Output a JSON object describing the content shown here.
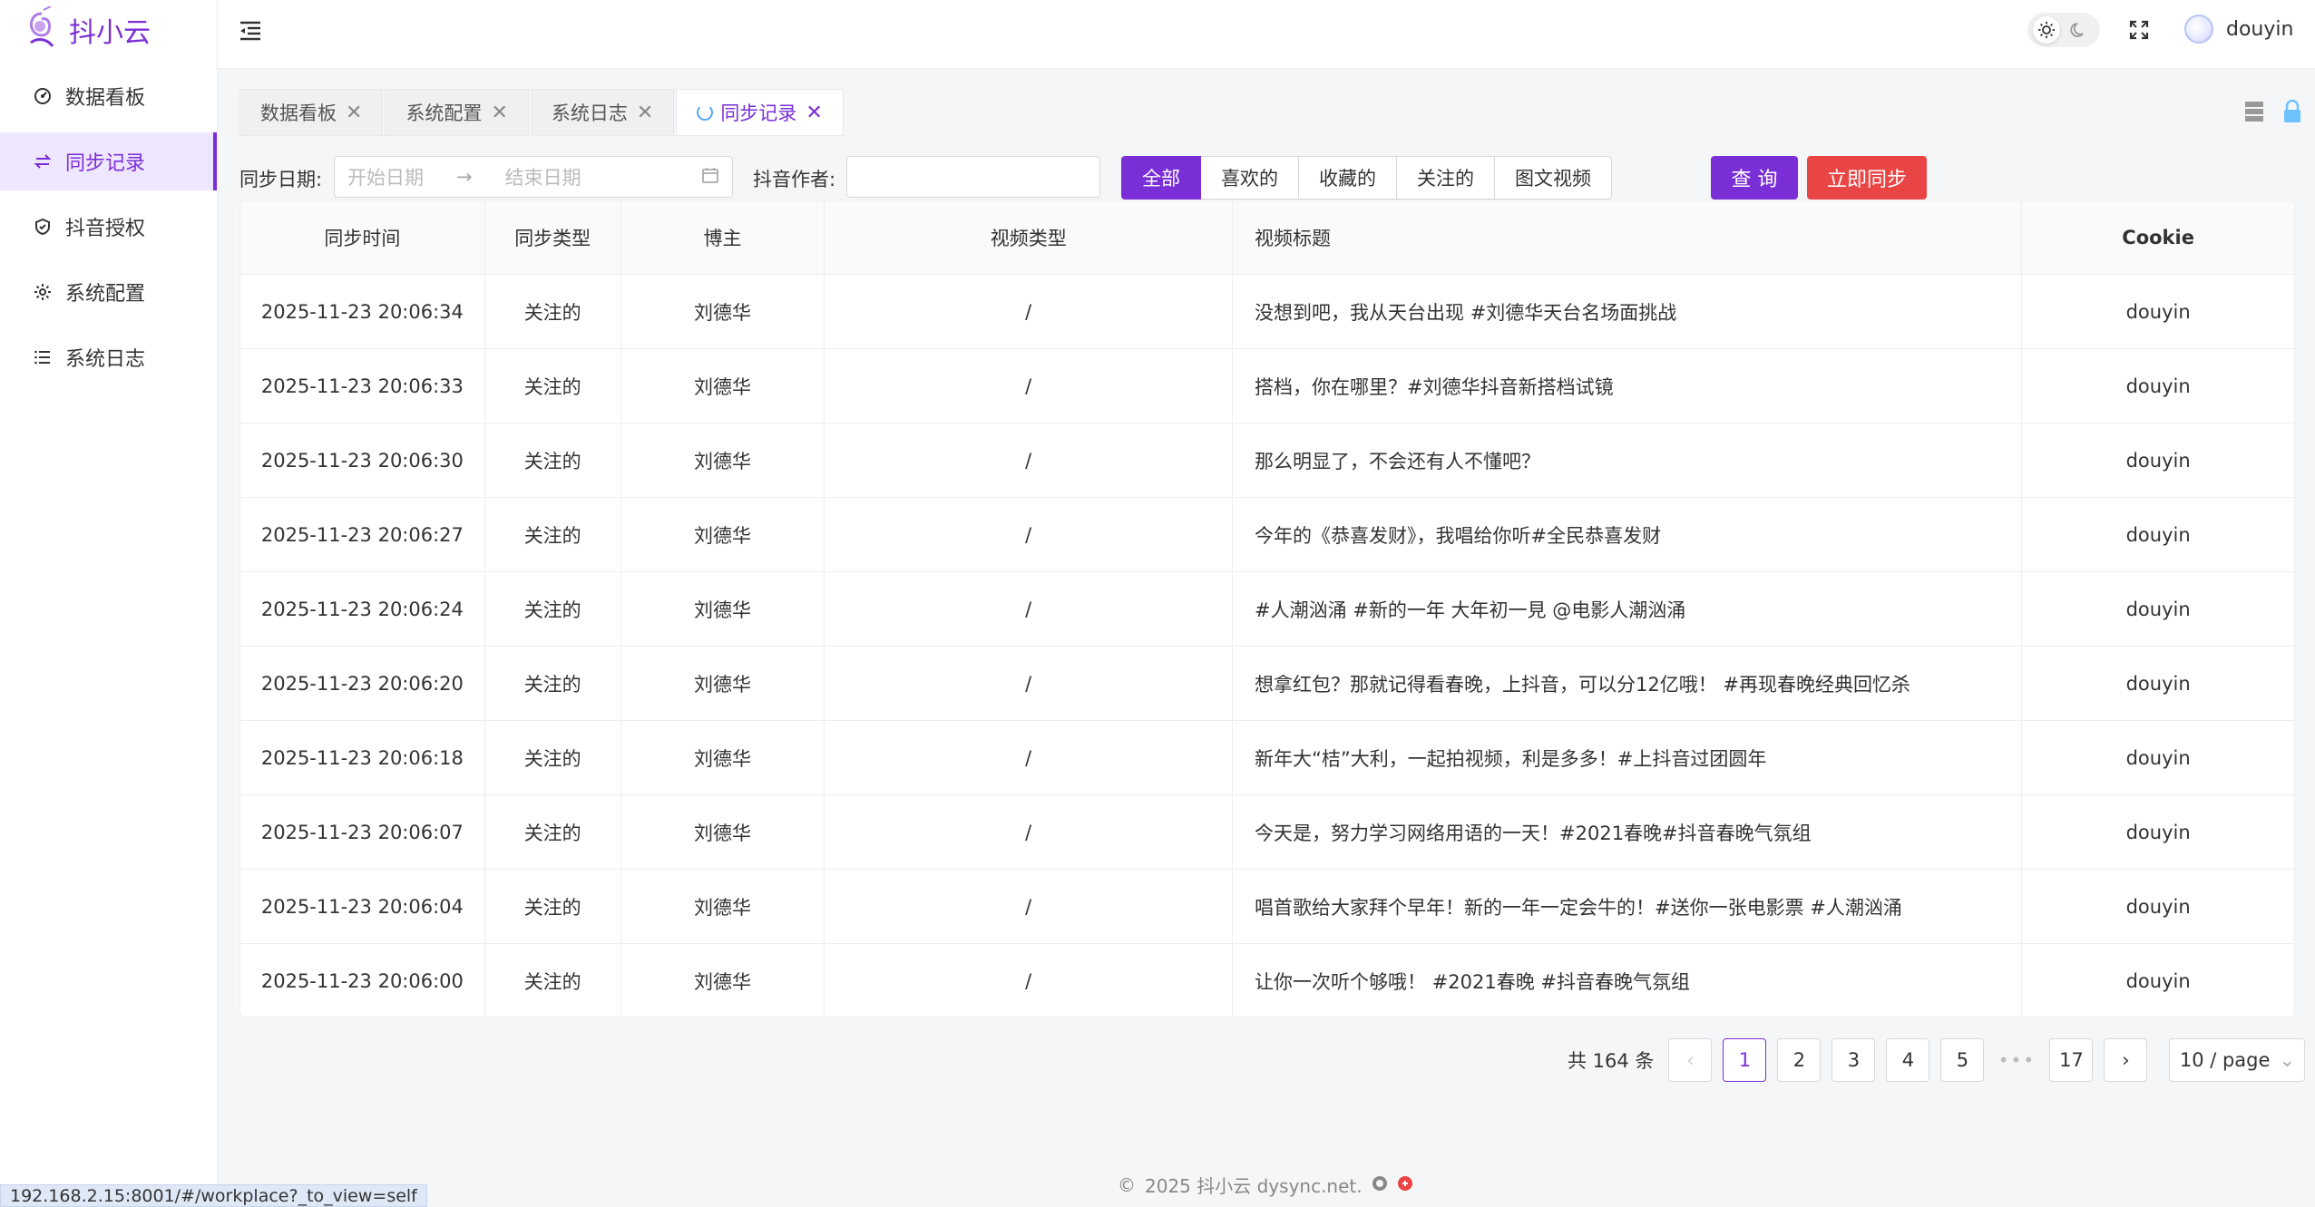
{
  "app": {
    "name": "抖小云"
  },
  "sidebar": {
    "items": [
      {
        "label": "数据看板",
        "icon": "dashboard-icon"
      },
      {
        "label": "同步记录",
        "icon": "sync-icon"
      },
      {
        "label": "抖音授权",
        "icon": "shield-icon"
      },
      {
        "label": "系统配置",
        "icon": "gear-icon"
      },
      {
        "label": "系统日志",
        "icon": "list-icon"
      }
    ],
    "active": "同步记录"
  },
  "header": {
    "username": "douyin"
  },
  "tabs": [
    {
      "label": "数据看板"
    },
    {
      "label": "系统配置"
    },
    {
      "label": "系统日志"
    },
    {
      "label": "同步记录",
      "active": true
    }
  ],
  "filter": {
    "date_label": "同步日期:",
    "start_placeholder": "开始日期",
    "end_placeholder": "结束日期",
    "author_label": "抖音作者:",
    "author_value": "",
    "segments": [
      "全部",
      "喜欢的",
      "收藏的",
      "关注的",
      "图文视频"
    ],
    "active_segment": "全部",
    "query_label": "查 询",
    "sync_label": "立即同步"
  },
  "table": {
    "headers": [
      "同步时间",
      "同步类型",
      "博主",
      "视频类型",
      "视频标题",
      "Cookie"
    ],
    "rows": [
      [
        "2025-11-23 20:06:34",
        "关注的",
        "刘德华",
        "/",
        "没想到吧，我从天台出现 #刘德华天台名场面挑战",
        "douyin"
      ],
      [
        "2025-11-23 20:06:33",
        "关注的",
        "刘德华",
        "/",
        "搭档，你在哪里？#刘德华抖音新搭档试镜",
        "douyin"
      ],
      [
        "2025-11-23 20:06:30",
        "关注的",
        "刘德华",
        "/",
        "那么明显了，不会还有人不懂吧？",
        "douyin"
      ],
      [
        "2025-11-23 20:06:27",
        "关注的",
        "刘德华",
        "/",
        "今年的《恭喜发财》，我唱给你听#全民恭喜发财",
        "douyin"
      ],
      [
        "2025-11-23 20:06:24",
        "关注的",
        "刘德华",
        "/",
        "#人潮汹涌 #新的一年 大年初一見 @电影人潮汹涌",
        "douyin"
      ],
      [
        "2025-11-23 20:06:20",
        "关注的",
        "刘德华",
        "/",
        "想拿红包？那就记得看春晚，上抖音，可以分12亿哦！ #再现春晚经典回忆杀",
        "douyin"
      ],
      [
        "2025-11-23 20:06:18",
        "关注的",
        "刘德华",
        "/",
        "新年大“桔”大利，一起拍视频，利是多多！#上抖音过团圆年",
        "douyin"
      ],
      [
        "2025-11-23 20:06:07",
        "关注的",
        "刘德华",
        "/",
        "今天是，努力学习网络用语的一天！#2021春晚#抖音春晚气氛组",
        "douyin"
      ],
      [
        "2025-11-23 20:06:04",
        "关注的",
        "刘德华",
        "/",
        "唱首歌给大家拜个早年！新的一年一定会牛的！#送你一张电影票 #人潮汹涌",
        "douyin"
      ],
      [
        "2025-11-23 20:06:00",
        "关注的",
        "刘德华",
        "/",
        "让你一次听个够哦！ #2021春晚 #抖音春晚气氛组",
        "douyin"
      ]
    ]
  },
  "pagination": {
    "total": "共 164 条",
    "pages": [
      "1",
      "2",
      "3",
      "4",
      "5"
    ],
    "last": "17",
    "current": "1",
    "page_size": "10 / page"
  },
  "footer": {
    "text": "2025 抖小云 dysync.net."
  },
  "statusbar": {
    "url": "192.168.2.15:8001/#/workplace?_to_view=self"
  },
  "colors": {
    "accent": "#7a2fd6",
    "danger": "#e94545"
  }
}
